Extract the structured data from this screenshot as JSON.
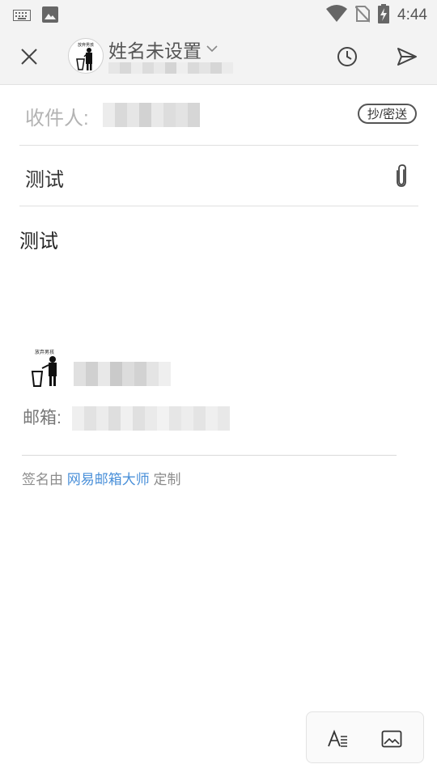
{
  "status_bar": {
    "time": "4:44",
    "icons": [
      "keyboard-icon",
      "image-icon",
      "wifi-icon",
      "no-sim-icon",
      "battery-charging-icon"
    ]
  },
  "toolbar": {
    "close_icon": "close-icon",
    "sender_name": "姓名未设置",
    "history_icon": "clock-icon",
    "send_icon": "send-icon"
  },
  "recipient": {
    "label": "收件人:",
    "cc_button": "抄/密送"
  },
  "subject": {
    "value": "测试",
    "attach_icon": "paperclip-icon"
  },
  "body": {
    "text": "测试"
  },
  "signature": {
    "logo_caption": "放弃男孩",
    "email_label": "邮箱:",
    "footer_prefix": "签名由",
    "footer_link": "网易邮箱大师",
    "footer_suffix": "定制"
  },
  "format_bar": {
    "text_format_icon": "text-format-icon",
    "insert_image_icon": "insert-image-icon"
  },
  "colors": {
    "toolbar_bg": "#f3f3f3",
    "link": "#4a90d9",
    "placeholder": "#b3b3b3"
  }
}
